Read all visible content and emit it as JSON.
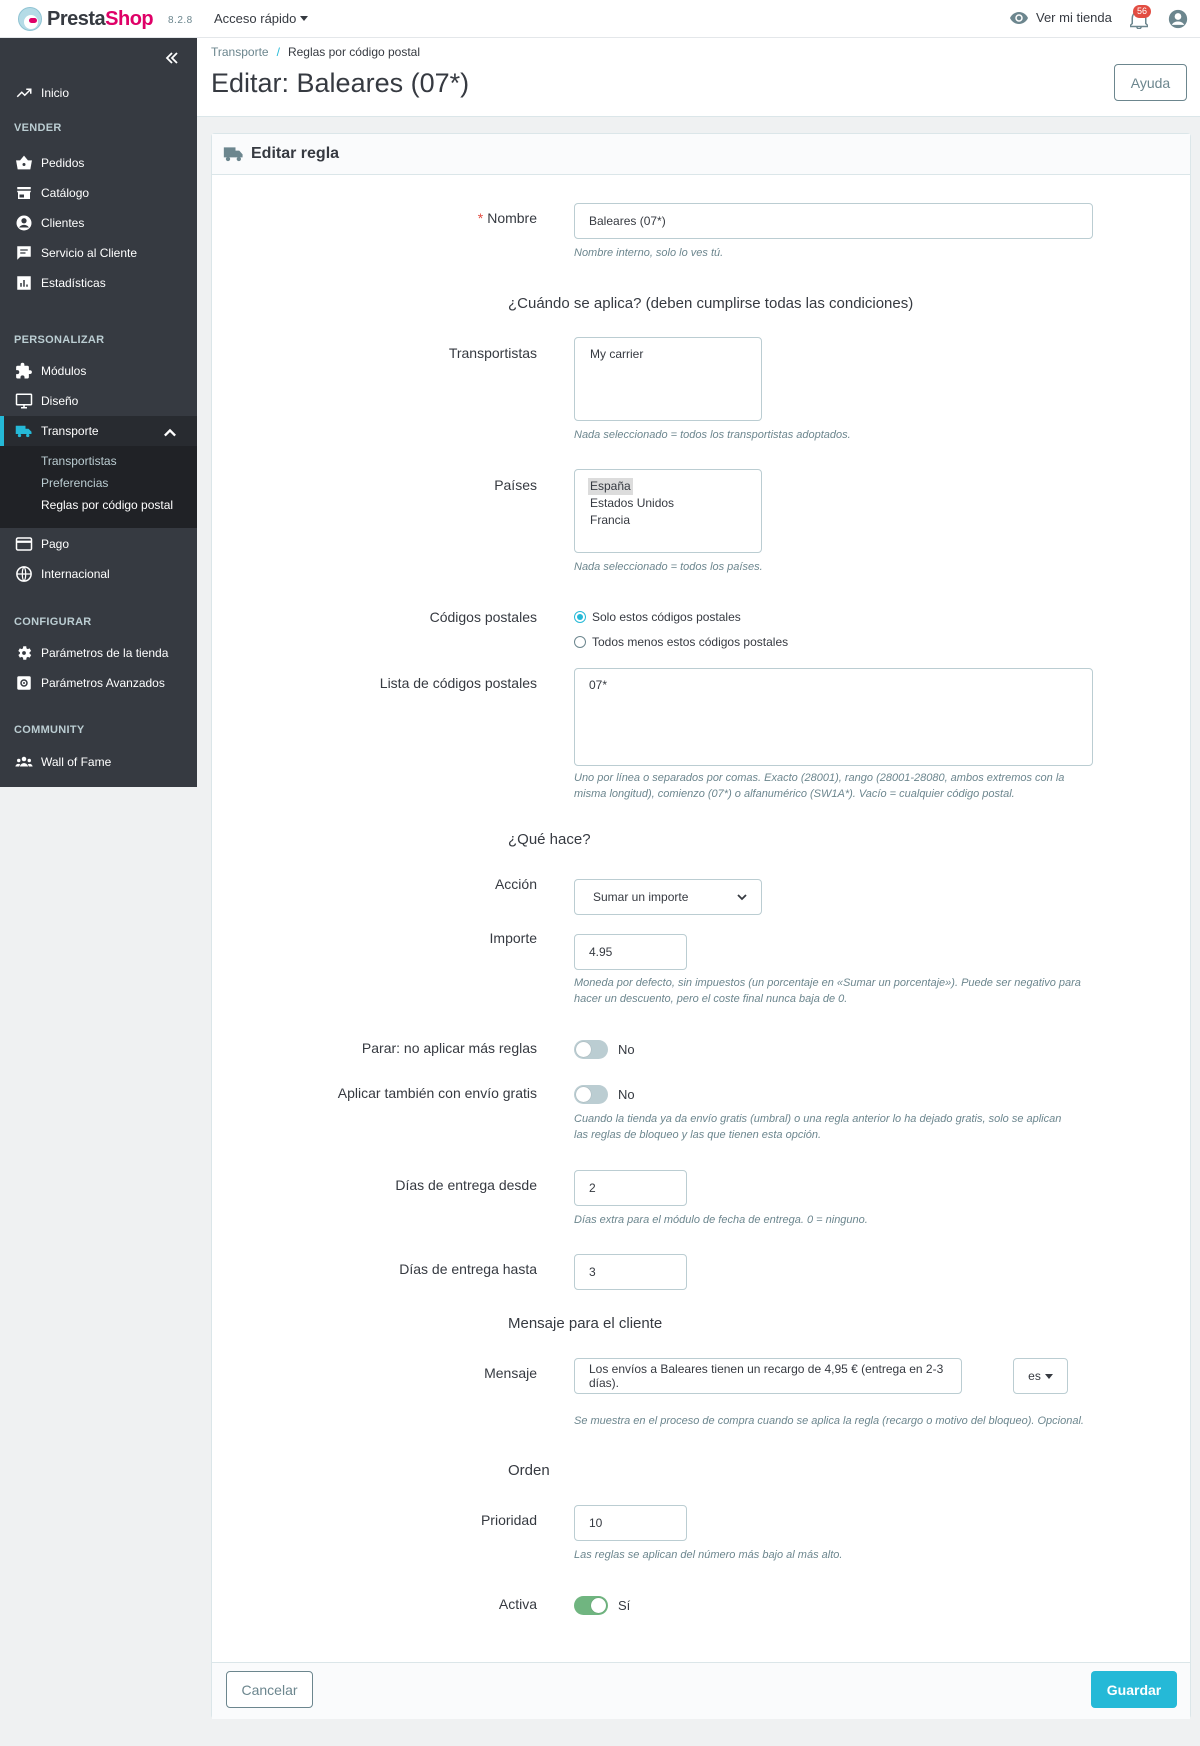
{
  "topbar": {
    "logo_pre": "Presta",
    "logo_accent": "Shop",
    "version": "8.2.8",
    "quick_access": "Acceso rápido",
    "view_store": "Ver mi tienda",
    "notifications_count": "56"
  },
  "sidebar": {
    "home": "Inicio",
    "sections": {
      "sell": "VENDER",
      "customize": "PERSONALIZAR",
      "configure": "CONFIGURAR",
      "community": "COMMUNITY"
    },
    "items": {
      "orders": "Pedidos",
      "catalog": "Catálogo",
      "customers": "Clientes",
      "customer_service": "Servicio al Cliente",
      "stats": "Estadísticas",
      "modules": "Módulos",
      "design": "Diseño",
      "shipping": "Transporte",
      "payment": "Pago",
      "international": "Internacional",
      "shop_params": "Parámetros de la tienda",
      "advanced_params": "Parámetros Avanzados",
      "wall_of_fame": "Wall of Fame"
    },
    "shipping_sub": {
      "carriers": "Transportistas",
      "preferences": "Preferencias",
      "postcode_rules": "Reglas por código postal"
    }
  },
  "header": {
    "breadcrumb_parent": "Transporte",
    "breadcrumb_sep": "/",
    "breadcrumb_current": "Reglas por código postal",
    "title": "Editar: Baleares (07*)",
    "help_button": "Ayuda"
  },
  "form": {
    "panel_title": "Editar regla",
    "name": {
      "label": "Nombre",
      "required_mark": "*",
      "value": "Baleares (07*)",
      "help": "Nombre interno, solo lo ves tú."
    },
    "when_title": "¿Cuándo se aplica? (deben cumplirse todas las condiciones)",
    "carriers": {
      "label": "Transportistas",
      "options": [
        "My carrier"
      ],
      "help": "Nada seleccionado = todos los transportistas adoptados."
    },
    "countries": {
      "label": "Países",
      "options": [
        "España",
        "Estados Unidos",
        "Francia"
      ],
      "selected": "España",
      "help": "Nada seleccionado = todos los países."
    },
    "postcodes": {
      "label": "Códigos postales",
      "option_only": "Solo estos códigos postales",
      "option_except": "Todos menos estos códigos postales",
      "selected": "only"
    },
    "postcode_list": {
      "label": "Lista de códigos postales",
      "value": "07*",
      "help_line1": "Uno por línea o separados por comas. Exacto (28001), rango (28001-28080, ambos extremos con la",
      "help_line2": "misma longitud), comienzo (07*) o alfanumérico (SW1A*). Vacío = cualquier código postal."
    },
    "what_title": "¿Qué hace?",
    "action": {
      "label": "Acción",
      "value": "Sumar un importe"
    },
    "amount": {
      "label": "Importe",
      "value": "4.95",
      "help_line1": "Moneda por defecto, sin impuestos (un porcentaje en «Sumar un porcentaje»). Puede ser negativo para",
      "help_line2": "hacer un descuento, pero el coste final nunca baja de 0."
    },
    "stop": {
      "label": "Parar: no aplicar más reglas",
      "state": "No"
    },
    "free_shipping": {
      "label": "Aplicar también con envío gratis",
      "state": "No",
      "help_line1": "Cuando la tienda ya da envío gratis (umbral) o una regla anterior lo ha dejado gratis, solo se aplican",
      "help_line2": "las reglas de bloqueo y las que tienen esta opción."
    },
    "delivery_from": {
      "label": "Días de entrega desde",
      "value": "2",
      "help": "Días extra para el módulo de fecha de entrega. 0 = ninguno."
    },
    "delivery_to": {
      "label": "Días de entrega hasta",
      "value": "3"
    },
    "message_title": "Mensaje para el cliente",
    "message": {
      "label": "Mensaje",
      "value": "Los envíos a Baleares tienen un recargo de 4,95 € (entrega en 2-3 días).",
      "lang": "es",
      "help": "Se muestra en el proceso de compra cuando se aplica la regla (recargo o motivo del bloqueo). Opcional."
    },
    "order_title": "Orden",
    "priority": {
      "label": "Prioridad",
      "value": "10",
      "help": "Las reglas se aplican del número más bajo al más alto."
    },
    "active": {
      "label": "Activa",
      "state": "Sí"
    },
    "cancel_button": "Cancelar",
    "save_button": "Guardar"
  },
  "colors": {
    "accent": "#25b9d7",
    "sidebar_bg": "#363a41",
    "switch_on": "#70b580",
    "required": "#e24d42"
  }
}
